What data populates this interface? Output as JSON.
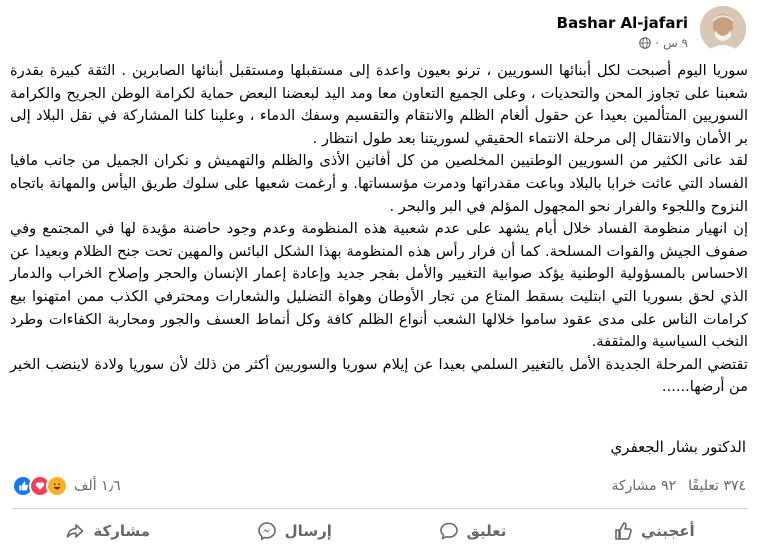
{
  "post": {
    "author": "Bashar Al-jafari",
    "time": "٩ س",
    "text": "سوريا اليوم أصبحت لكل أبنائها السوريين ، ترنو بعيون واعدة إلى مستقبلها  ومستقبل أبنائها الصابرين . الثقة كبيرة بقدرة شعبنا على تجاوز المحن والتحديات ، وعلى الجميع التعاون معا ومد اليد لبعضنا البعض حماية لكرامة الوطن الجريح  والكرامة السوريين المتألمين  بعيدا عن حقول ألغام الظلم والانتقام والتقسيم وسفك الدماء ، وعلينا كلنا المشاركة في نقل البلاد إلى بر الأمان والانتقال إلى مرحلة الانتماء الحقيقي لسوريتنا بعد طول انتظار .\nلقد عانى الكثير من السوريين الوطنيين المخلصين من كل أفانين الأذى والظلم والتهميش  و نكران الجميل من جانب مافيا الفساد التي عاثت خرابا بالبلاد وباعت مقدراتها  ودمرت مؤسساتها. و أرغمت شعبها على سلوك طريق اليأس والمهانة باتجاه النزوح واللجوء والفرار نحو المجهول المؤلم في البر والبحر .\nإن انهيار منظومة الفساد خلال أيام يشهد على عدم شعبية هذه المنظومة وعدم وجود حاضنة مؤيدة لها في المجتمع وفي صفوف الجيش والقوات المسلحة. كما أن فرار رأس هذه المنظومة بهذا الشكل البائس والمهين تحت جنح الظلام وبعيدا عن الاحساس بالمسؤولية الوطنية يؤكد صوابية التغيير والأمل بفجر جديد وإعادة إعمار الإنسان والحجر وإصلاح الخراب والدمار الذي لحق بسوريا التي ابتليت  بسقط المتاع من تجار الأوطان وهواة التضليل والشعارات ومحترفي الكذب ممن امتهنوا  بيع كرامات الناس على مدى عقود ساموا خلالها الشعب أنواع الظلم كافة وكل أنماط العسف والجور ومحاربة الكفاءات وطرد النخب السياسية والمثقفة.\nتقتضي المرحلة الجديدة الأمل بالتغيير السلمي بعيدا عن إيلام سوريا والسوريين أكثر من ذلك لأن سوريا ولادة لاينضب الخير من أرضها......",
    "signature": "الدكتور بشار الجعفري"
  },
  "stats": {
    "reactions_count": "١٫٦ ألف",
    "comments": "٣٧٤ تعليقًا",
    "shares": "٩٢ مشاركة"
  },
  "actions": {
    "like": "أعجبني",
    "comment": "تعليق",
    "send": "إرسال",
    "share": "مشاركة"
  },
  "icons": {
    "audience": "globe-icon",
    "reactions": [
      "like-reaction-icon",
      "love-reaction-icon",
      "haha-reaction-icon"
    ],
    "like": "thumbs-up-icon",
    "comment": "comment-bubble-icon",
    "send": "messenger-icon",
    "share": "share-arrow-icon"
  },
  "colors": {
    "like_blue": "#1877f2",
    "love_red": "#f33e58",
    "haha_yellow": "#f7b125",
    "secondary_text": "#65676b"
  }
}
